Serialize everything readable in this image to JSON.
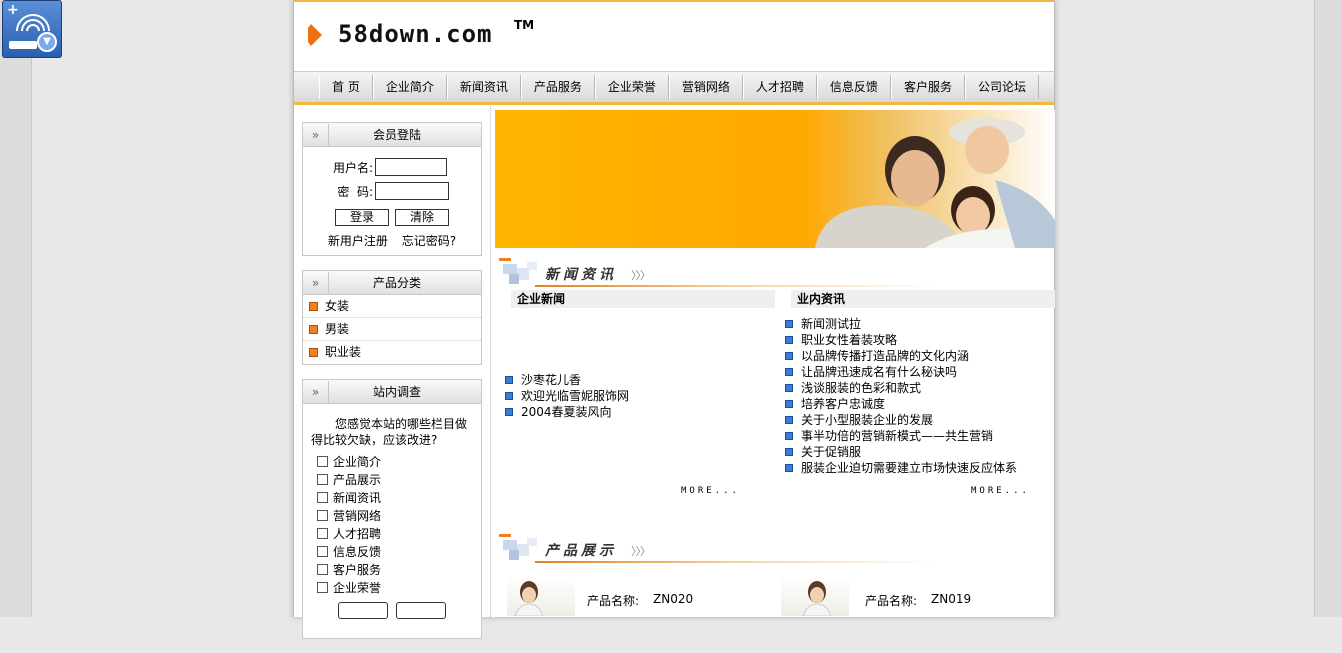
{
  "header": {
    "logo_text": "58down.com",
    "logo_tm": "TM"
  },
  "nav": [
    "首 页",
    "企业简介",
    "新闻资讯",
    "产品服务",
    "企业荣誉",
    "营销网络",
    "人才招聘",
    "信息反馈",
    "客户服务",
    "公司论坛"
  ],
  "login": {
    "title": "会员登陆",
    "username_label": "用户名:",
    "password_label": "密  码:",
    "login_button": "登录",
    "clear_button": "清除",
    "register_link": "新用户注册",
    "forgot_link": "忘记密码?"
  },
  "categories": {
    "title": "产品分类",
    "items": [
      "女装",
      "男装",
      "职业装"
    ]
  },
  "survey": {
    "title": "站内调查",
    "question": "您感觉本站的哪些栏目做得比较欠缺，应该改进?",
    "options": [
      "企业简介",
      "产品展示",
      "新闻资讯",
      "营销网络",
      "人才招聘",
      "信息反馈",
      "客户服务",
      "企业荣誉"
    ]
  },
  "news_section": {
    "title": "新闻资讯",
    "company_news": {
      "heading": "企业新闻",
      "items": [
        "沙枣花儿香",
        "欢迎光临雪妮服饰网",
        "2004春夏装风向"
      ],
      "more": "MORE..."
    },
    "industry_news": {
      "heading": "业内资讯",
      "items": [
        "新闻测试拉",
        "职业女性着装攻略",
        "以品牌传播打造品牌的文化内涵",
        "让品牌迅速成名有什么秘诀吗",
        "浅谈服装的色彩和款式",
        "培养客户忠诚度",
        "关于小型服装企业的发展",
        "事半功倍的营销新模式——共生营销",
        "关于促销服",
        "服装企业迫切需要建立市场快速反应体系"
      ],
      "more": "MORE..."
    }
  },
  "product_section": {
    "title": "产品展示",
    "items": [
      {
        "label": "产品名称:",
        "code": "ZN020"
      },
      {
        "label": "产品名称:",
        "code": "ZN019"
      }
    ]
  }
}
